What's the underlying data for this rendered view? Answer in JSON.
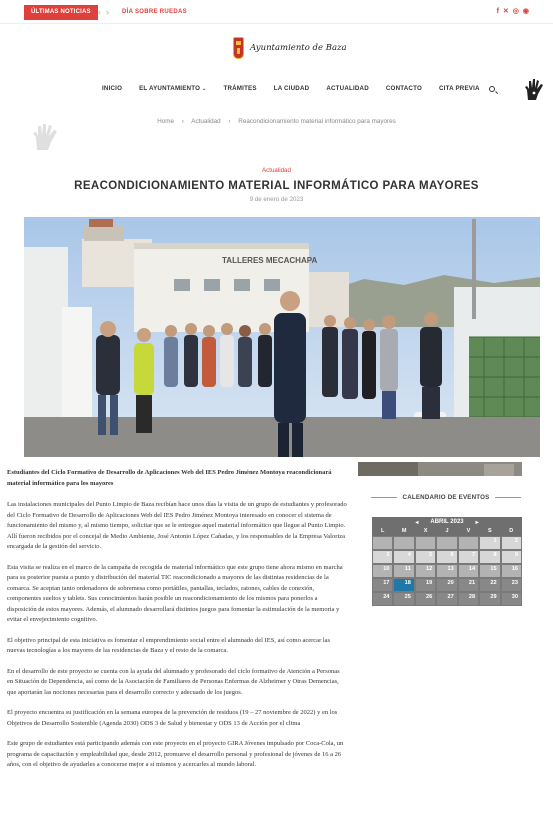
{
  "topbar": {
    "ticker_label": "ÚLTIMAS NOTICIAS",
    "ticker_prev": "‹",
    "ticker_next": "›",
    "ticker_text": "DÍA SOBRE RUEDAS",
    "social": [
      "f",
      "✕",
      "◎",
      "◉"
    ]
  },
  "header": {
    "logo_text": "Ayuntamiento de Baza"
  },
  "nav": {
    "items": [
      "INICIO",
      "EL AYUNTAMIENTO",
      "TRÁMITES",
      "LA CIUDAD",
      "ACTUALIDAD",
      "CONTACTO",
      "CITA PREVIA"
    ]
  },
  "breadcrumb": {
    "home": "Home",
    "section": "Actualidad",
    "current": "Reacondicionamiento material informático para mayores",
    "separator": "›"
  },
  "article": {
    "category": "Actualidad",
    "title": "REACONDICIONAMIENTO MATERIAL INFORMÁTICO PARA MAYORES",
    "date": "9 de enero de 2023",
    "photo_sign": "TALLERES MECACHAPA",
    "lead": "Estudiantes del Ciclo Formativo de Desarrollo de Aplicaciones Web del IES Pedro Jiménez Montoya reacondicionará material informático para los mayores",
    "paragraphs": [
      "Las instalaciones municipales del Punto Limpio de Baza recibían hace unos días la visita de un grupo de estudiantes y profesorado del Ciclo Formativo de Desarrollo de Aplicaciones Web del IES Pedro Jiménez Montoya interesado en conocer el sistema de funcionamiento del mismo y, al mismo tiempo, solicitar que se le entregue aquel material informático que llegue al Punto Limpio. Allí fueron recibidos por el concejal de Medio Ambiente, José Antonio López Cañadas, y los responsables de la Empresa Valoriza encargada de la gestión del servicio.",
      "Esta visita se realiza en el marco de la campaña de recogida de material informático que este grupo tiene ahora mismo en marcha para su posterior puesta a punto y distribución del material TIC reacondicionado a mayores de las distintas residencias de la comarca. Se aceptan tanto ordenadores de sobremesa como portátiles, pantallas, teclados, ratones, cables de conexión, componentes sueltos y tablets. Sus conocimientos harán posible un reacondicionamiento de los mismos para ponerlos a disposición de estos mayores. Además, el alumnado desarrollará distintos juegos para fomentar la estimulación de la memoria y evitar el envejecimiento cognitivo.",
      "El objetivo principal de esta iniciativa es fomentar el emprendimiento social entre el alumnado del IES, así como acercar las nuevas tecnologías a los mayores de las residencias de Baza y el resto de la comarca.",
      "En el desarrollo de este proyecto se cuenta con la ayuda del alumnado y profesorado del ciclo formativo de Atención a Personas en Situación de Dependencia, así como de la Asociación de Familiares de Personas Enfermas de Alzheimer y Otras Demencias, que aportarán las nociones necesarias para el desarrollo correcto y adecuado de los juegos.",
      "El proyecto encuentra su justificación en la semana europea de la prevención de residuos (19 – 27 noviembre de 2022) y en los Objetivos de Desarrollo Sostenible (Agenda 2030) ODS 3 de Salud y bienestar y ODS 13 de Acción por el clima",
      "Este grupo de estudiantes está participando además con este proyecto en el proyecto GIRA Jóvenes impulsado por Coca-Cola, un programa de capacitación y empleabilidad que, desde 2012, promueve el desarrollo personal y profesional de jóvenes de 16 a 26 años, con el objetivo de ayudarles a conocerse mejor a sí mismos y acercarles al mundo laboral."
    ]
  },
  "sidebar": {
    "calendar_title": "CALENDARIO DE EVENTOS",
    "calendar": {
      "month_label": "ABRIL 2023",
      "prev": "◂",
      "next": "▸",
      "weekdays": [
        "L",
        "M",
        "X",
        "J",
        "V",
        "S",
        "D"
      ],
      "weeks": [
        [
          "",
          "",
          "",
          "",
          "",
          "1",
          "2"
        ],
        [
          "3",
          "4",
          "5",
          "6",
          "7",
          "8",
          "9"
        ],
        [
          "10",
          "11",
          "12",
          "13",
          "14",
          "15",
          "16"
        ],
        [
          "17",
          "18",
          "19",
          "20",
          "21",
          "22",
          "23"
        ],
        [
          "24",
          "25",
          "26",
          "27",
          "28",
          "29",
          "30"
        ]
      ],
      "today": "18"
    }
  }
}
